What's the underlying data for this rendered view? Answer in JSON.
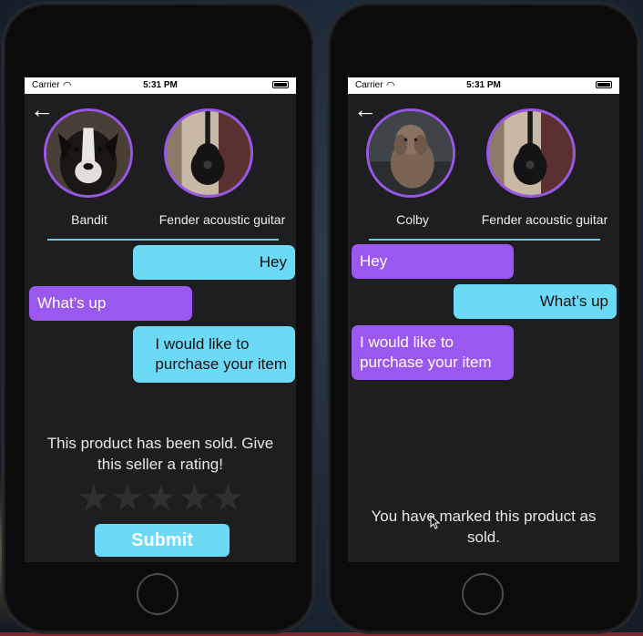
{
  "status_bar": {
    "carrier": "Carrier",
    "time": "5:31 PM"
  },
  "colors": {
    "accent_cyan": "#6cdaf6",
    "accent_purple": "#9b58f0",
    "ring_purple": "#9a57e6"
  },
  "left_phone": {
    "avatar_user_name": "Bandit",
    "avatar_item_name": "Fender acoustic guitar",
    "messages": [
      {
        "side": "out",
        "text": "Hey"
      },
      {
        "side": "in",
        "text": "What’s up"
      },
      {
        "side": "out",
        "line1": "I would like to",
        "line2": "purchase your item"
      }
    ],
    "sold_line1": "This product has been sold. Give",
    "sold_line2": "this seller a rating!",
    "rating_stars": 0,
    "submit_label": "Submit"
  },
  "right_phone": {
    "avatar_user_name": "Colby",
    "avatar_item_name": "Fender acoustic guitar",
    "messages": [
      {
        "side": "in",
        "text": "Hey"
      },
      {
        "side": "out",
        "text": "What’s up"
      },
      {
        "side": "in",
        "line1": "I would like to",
        "line2": "purchase your item"
      }
    ],
    "marked_line1": "You have marked this product as",
    "marked_line2": "sold."
  }
}
